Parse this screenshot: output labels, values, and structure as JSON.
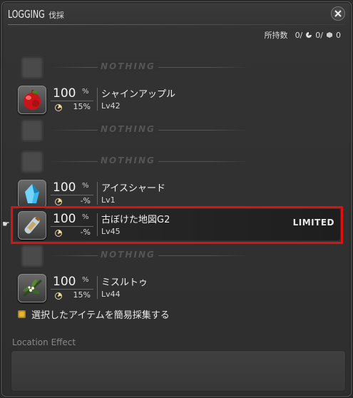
{
  "window": {
    "title_main": "LOGGING",
    "title_sub": "伐採",
    "close_icon": "close-x-icon"
  },
  "stats": {
    "label": "所持数",
    "v1": "0/",
    "v2": "0/",
    "v3": "0"
  },
  "rows": [
    {
      "type": "empty",
      "text": "NOTHING"
    },
    {
      "type": "item",
      "icon": "apple",
      "pct": "100",
      "pct_sym": "%",
      "hq": "15%",
      "name": "シャインアップル",
      "lv": "Lv42"
    },
    {
      "type": "empty",
      "text": "NOTHING"
    },
    {
      "type": "empty",
      "text": "NOTHING"
    },
    {
      "type": "item",
      "icon": "ice-shard",
      "pct": "100",
      "pct_sym": "%",
      "hq": "-%",
      "name": "アイスシャード",
      "lv": "Lv1"
    },
    {
      "type": "item",
      "icon": "bottle-map",
      "pct": "100",
      "pct_sym": "%",
      "hq": "-%",
      "name": "古ぼけた地図G2",
      "lv": "Lv45",
      "badge": "LIMITED",
      "selected": true
    },
    {
      "type": "empty",
      "text": "NOTHING"
    },
    {
      "type": "item",
      "icon": "mistletoe",
      "pct": "100",
      "pct_sym": "%",
      "hq": "15%",
      "name": "ミスルトゥ",
      "lv": "Lv44"
    }
  ],
  "checkbox": {
    "label": "選択したアイテムを簡易採集する",
    "checked": true
  },
  "location_effect": {
    "label": "Location Effect"
  },
  "colors": {
    "highlight": "#e01010",
    "checkbox": "#e8b830"
  }
}
